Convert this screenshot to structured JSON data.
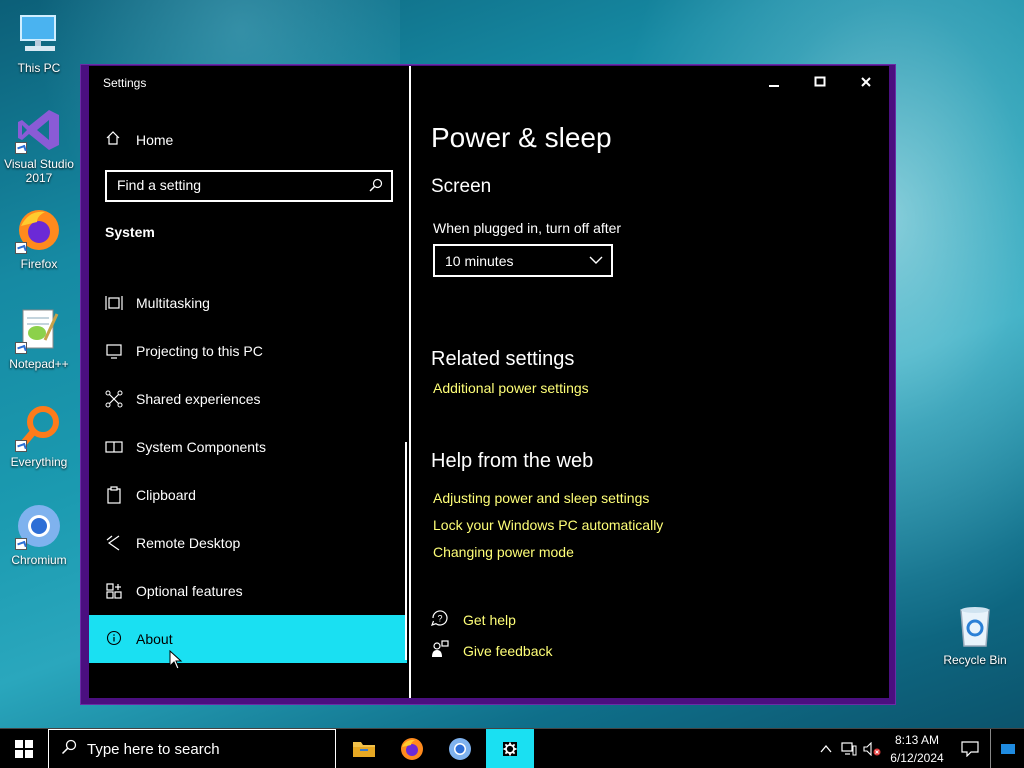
{
  "desktop": {
    "icons": [
      {
        "label": "This PC",
        "icon": "computer-icon"
      },
      {
        "label": "Visual Studio 2017",
        "icon": "visual-studio-icon"
      },
      {
        "label": "Firefox",
        "icon": "firefox-icon"
      },
      {
        "label": "Notepad++",
        "icon": "notepadpp-icon"
      },
      {
        "label": "Everything",
        "icon": "everything-icon"
      },
      {
        "label": "Chromium",
        "icon": "chromium-icon"
      },
      {
        "label": "Recycle Bin",
        "icon": "recycle-bin-icon"
      }
    ]
  },
  "window": {
    "title": "Settings",
    "controls": {
      "minimize": "—",
      "maximize": "□",
      "close": "✕"
    }
  },
  "sidebar": {
    "home": "Home",
    "search_placeholder": "Find a setting",
    "section": "System",
    "items": [
      {
        "label": "Multitasking",
        "icon": "multitasking-icon"
      },
      {
        "label": "Projecting to this PC",
        "icon": "projecting-icon"
      },
      {
        "label": "Shared experiences",
        "icon": "shared-experiences-icon"
      },
      {
        "label": "System Components",
        "icon": "system-components-icon"
      },
      {
        "label": "Clipboard",
        "icon": "clipboard-icon"
      },
      {
        "label": "Remote Desktop",
        "icon": "remote-desktop-icon"
      },
      {
        "label": "Optional features",
        "icon": "optional-features-icon"
      },
      {
        "label": "About",
        "icon": "info-icon",
        "selected": true
      }
    ]
  },
  "content": {
    "title": "Power & sleep",
    "screen_heading": "Screen",
    "plugged_label": "When plugged in, turn off after",
    "plugged_value": "10 minutes",
    "related_heading": "Related settings",
    "related_link": "Additional power settings",
    "help_heading": "Help from the web",
    "help_links": [
      "Adjusting power and sleep settings",
      "Lock your Windows PC automatically",
      "Changing power mode"
    ],
    "get_help": "Get help",
    "give_feedback": "Give feedback"
  },
  "taskbar": {
    "search_placeholder": "Type here to search",
    "time": "8:13 AM",
    "date": "6/12/2024"
  },
  "colors": {
    "accent": "#1ae0f2",
    "link": "#ffff78",
    "window_border": "#4b0f80"
  }
}
